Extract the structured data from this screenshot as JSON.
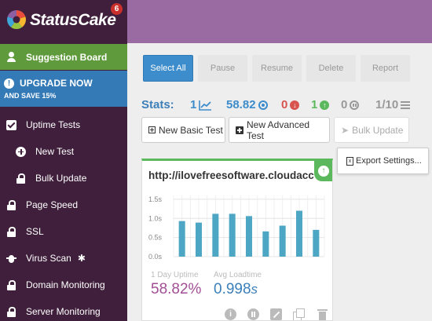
{
  "brand": {
    "name": "StatusCake",
    "notification_count": "6",
    "logo_colors": [
      "#e94e3c",
      "#f7b731",
      "#9ac43f",
      "#3fa6d8",
      "#8e5ea2"
    ]
  },
  "sidebar": {
    "suggestion_board": "Suggestion Board",
    "upgrade": {
      "line1": "UPGRADE NOW",
      "line2": "AND SAVE 15%"
    },
    "items": [
      {
        "label": "Uptime Tests",
        "icon": "check-square-icon"
      },
      {
        "label": "New Test",
        "icon": "plus-circle-icon"
      },
      {
        "label": "Bulk Update",
        "icon": "lock-icon"
      },
      {
        "label": "Page Speed",
        "icon": "lock-icon"
      },
      {
        "label": "SSL",
        "icon": "lock-icon"
      },
      {
        "label": "Virus Scan",
        "icon": "bug-icon",
        "suffix": "✱"
      },
      {
        "label": "Domain Monitoring",
        "icon": "lock-icon"
      },
      {
        "label": "Server Monitoring",
        "icon": "lock-icon"
      }
    ]
  },
  "toolbar": {
    "select_all": "Select All",
    "pause": "Pause",
    "resume": "Resume",
    "delete": "Delete",
    "report": "Report"
  },
  "stats": {
    "label": "Stats:",
    "up_tests": "1",
    "uptime_pct": "58.82",
    "down": "0",
    "up": "1",
    "paused": "0",
    "page": "1/10"
  },
  "actions": {
    "new_basic": "New Basic Test",
    "new_advanced": "New Advanced Test",
    "bulk_update": "Bulk Update",
    "export_settings": "Export Settings..."
  },
  "card": {
    "url": "http://ilovefreesoftware.cloudacc",
    "status": "up",
    "uptime_label": "1 Day Uptime",
    "uptime_value": "58.82%",
    "load_label": "Avg Loadtime",
    "load_value": "0.998",
    "load_unit": "s"
  },
  "chart_data": {
    "type": "bar",
    "values": [
      0.93,
      0.89,
      1.12,
      1.12,
      1.06,
      0.66,
      0.81,
      1.2,
      0.7
    ],
    "ylim": [
      0,
      1.6
    ],
    "yticks": [
      "1.5s",
      "1.0s",
      "0.5s",
      "0.0s"
    ],
    "ytick_values": [
      1.5,
      1.0,
      0.5,
      0.0
    ],
    "bar_color": "#4ca6c4",
    "grid": true
  },
  "colors": {
    "sidebar_bg": "#3f1f3b",
    "topbar": "#9a6aa3",
    "suggestion": "#5f9b3c",
    "upgrade": "#337ab7",
    "primary": "#3d8ccb",
    "up_green": "#5cb85c",
    "down_red": "#d9534f",
    "uptime_purple": "#a24e95"
  }
}
